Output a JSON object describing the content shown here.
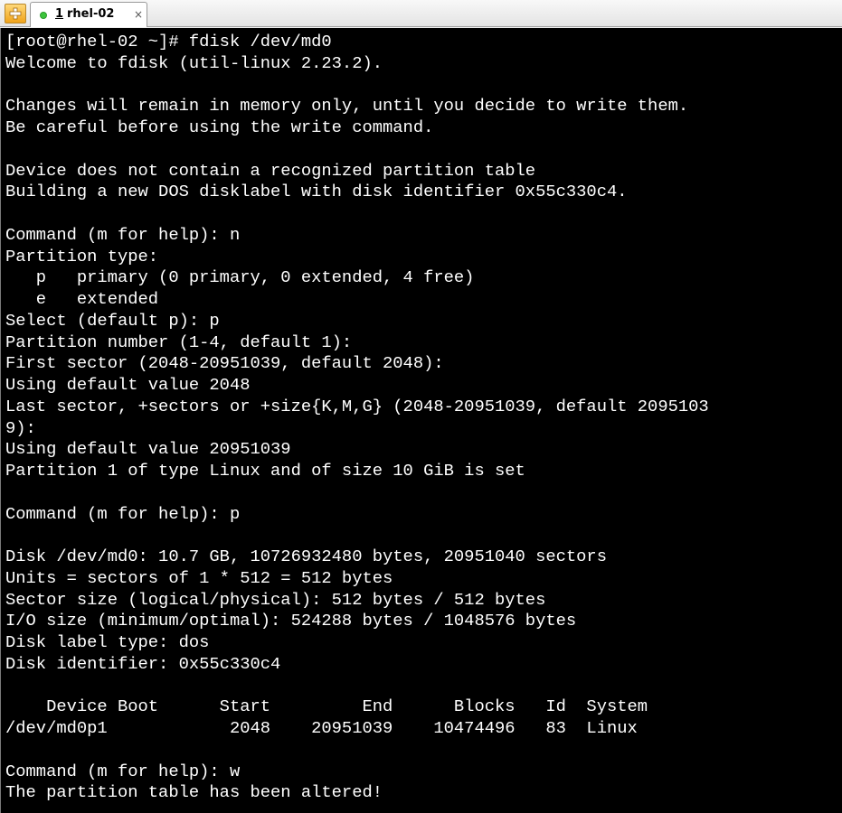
{
  "tab": {
    "number": "1",
    "title": "rhel-02",
    "close": "×",
    "status_color": "#3cc43c"
  },
  "new_tab_icon": "plus-icon",
  "terminal": {
    "lines": [
      "[root@rhel-02 ~]# fdisk /dev/md0",
      "Welcome to fdisk (util-linux 2.23.2).",
      "",
      "Changes will remain in memory only, until you decide to write them.",
      "Be careful before using the write command.",
      "",
      "Device does not contain a recognized partition table",
      "Building a new DOS disklabel with disk identifier 0x55c330c4.",
      "",
      "Command (m for help): n",
      "Partition type:",
      "   p   primary (0 primary, 0 extended, 4 free)",
      "   e   extended",
      "Select (default p): p",
      "Partition number (1-4, default 1):",
      "First sector (2048-20951039, default 2048):",
      "Using default value 2048",
      "Last sector, +sectors or +size{K,M,G} (2048-20951039, default 2095103",
      "9):",
      "Using default value 20951039",
      "Partition 1 of type Linux and of size 10 GiB is set",
      "",
      "Command (m for help): p",
      "",
      "Disk /dev/md0: 10.7 GB, 10726932480 bytes, 20951040 sectors",
      "Units = sectors of 1 * 512 = 512 bytes",
      "Sector size (logical/physical): 512 bytes / 512 bytes",
      "I/O size (minimum/optimal): 524288 bytes / 1048576 bytes",
      "Disk label type: dos",
      "Disk identifier: 0x55c330c4",
      "",
      "    Device Boot      Start         End      Blocks   Id  System",
      "/dev/md0p1            2048    20951039    10474496   83  Linux",
      "",
      "Command (m for help): w",
      "The partition table has been altered!"
    ]
  }
}
